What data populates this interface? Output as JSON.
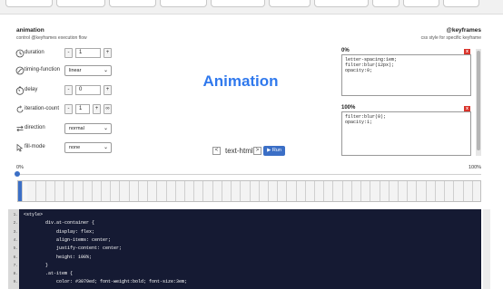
{
  "header": {
    "title": "animation",
    "subtitle": "control @keyframes execution flow",
    "right_title": "@keyframes",
    "right_subtitle": "css style for specific keyframe"
  },
  "properties": [
    {
      "label": "duration",
      "type": "stepper",
      "value": "1",
      "icon": "clock-icon"
    },
    {
      "label": "timing-function",
      "type": "select",
      "value": "linear",
      "icon": "curve-icon"
    },
    {
      "label": "delay",
      "type": "stepper",
      "value": "0",
      "icon": "stopwatch-icon"
    },
    {
      "label": "iteration-count",
      "type": "stepper_inf",
      "value": "1",
      "icon": "repeat-icon"
    },
    {
      "label": "direction",
      "type": "select",
      "value": "normal",
      "icon": "arrows-icon"
    },
    {
      "label": "fill-mode",
      "type": "select",
      "value": "none",
      "icon": "cursor-icon"
    }
  ],
  "stepper": {
    "minus": "-",
    "plus": "+",
    "inf": "∞"
  },
  "stage": {
    "text": "Animation",
    "nav_label": "text-html",
    "prev": "<",
    "next": ">",
    "run_label": "▶ Run",
    "text_color": "#3079ed"
  },
  "keyframes": [
    {
      "label": "0%",
      "css": "letter-spacing:1em;\nfilter:blur(12px);\nopacity:0;",
      "delete": "x"
    },
    {
      "label": "100%",
      "css": "filter:blur(0);\nopacity:1;",
      "delete": "x"
    }
  ],
  "progress": {
    "start_label": "0%",
    "end_label": "100%",
    "value": 0
  },
  "code": {
    "lines": [
      {
        "n": "1.",
        "t": "<style>"
      },
      {
        "n": "2.",
        "t": "        div.at-container {"
      },
      {
        "n": "3.",
        "t": "            display: flex;"
      },
      {
        "n": "4.",
        "t": "            align-items: center;"
      },
      {
        "n": "5.",
        "t": "            justify-content: center;"
      },
      {
        "n": "6.",
        "t": "            height: 100%;"
      },
      {
        "n": "7.",
        "t": "        }"
      },
      {
        "n": "8.",
        "t": "        .at-item {"
      },
      {
        "n": "9.",
        "t": "            color: #3079ed; font-weight:bold; font-size:3em;"
      },
      {
        "n": "10.",
        "t": ""
      }
    ]
  },
  "colors": {
    "accent": "#3b6fc6",
    "code_bg": "#151a33",
    "danger": "#d9342b"
  }
}
